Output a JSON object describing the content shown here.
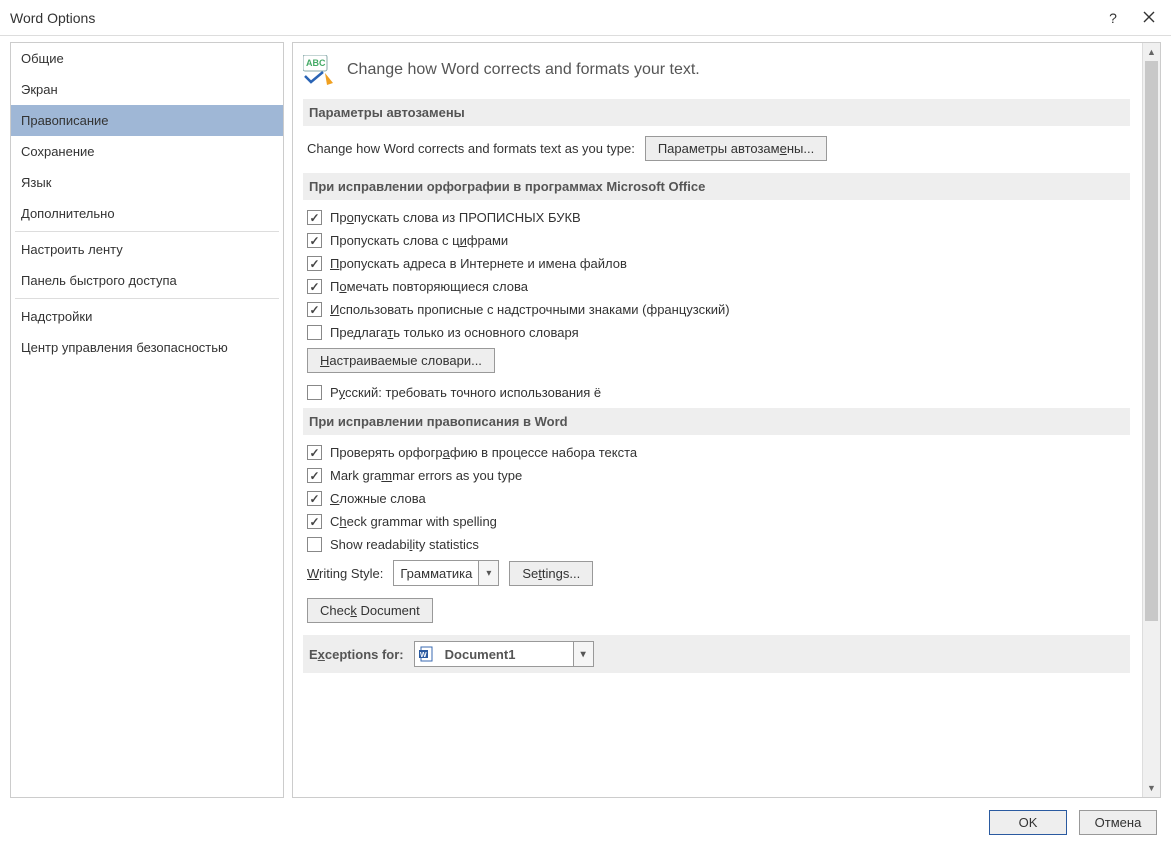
{
  "title": "Word Options",
  "sidebar": {
    "items": [
      {
        "label": "Общие"
      },
      {
        "label": "Экран"
      },
      {
        "label": "Правописание"
      },
      {
        "label": "Сохранение"
      },
      {
        "label": "Язык"
      },
      {
        "label": "Дополнительно"
      },
      {
        "label": "Настроить ленту"
      },
      {
        "label": "Панель быстрого доступа"
      },
      {
        "label": "Надстройки"
      },
      {
        "label": "Центр управления безопасностью"
      }
    ],
    "selected": 2
  },
  "hero": "Change how Word corrects and formats your text.",
  "section1": {
    "header": "Параметры автозамены",
    "desc": "Change how Word corrects and formats text as you type:",
    "button": "Параметры автозамены..."
  },
  "section2": {
    "header": "При исправлении орфографии в программах Microsoft Office",
    "checks": [
      {
        "checked": true,
        "label": "Пропускать слова из ПРОПИСНЫХ БУКВ"
      },
      {
        "checked": true,
        "label": "Пропускать слова с цифрами"
      },
      {
        "checked": true,
        "label": "Пропускать адреса в Интернете и имена файлов"
      },
      {
        "checked": true,
        "label": "Помечать повторяющиеся слова"
      },
      {
        "checked": true,
        "label": "Использовать прописные с надстрочными знаками (французский)"
      },
      {
        "checked": false,
        "label": "Предлагать только из основного словаря"
      }
    ],
    "custom_dict_btn": "Настраиваемые словари...",
    "check7": {
      "checked": false,
      "label": "Русский: требовать точного использования ё"
    }
  },
  "section3": {
    "header": "При исправлении правописания в Word",
    "checks": [
      {
        "checked": true,
        "label": "Проверять орфографию в процессе набора текста"
      },
      {
        "checked": true,
        "label": "Mark grammar errors as you type"
      },
      {
        "checked": true,
        "label": "Сложные слова"
      },
      {
        "checked": true,
        "label": "Check grammar with spelling"
      },
      {
        "checked": false,
        "label": "Show readability statistics"
      }
    ],
    "writing_style_label": "Writing Style:",
    "writing_style_value": "Грамматика",
    "settings_btn": "Settings...",
    "check_doc_btn": "Check Document"
  },
  "section4": {
    "header_prefix": "Exceptions for:",
    "doc": "Document1"
  },
  "footer": {
    "ok": "OK",
    "cancel": "Отмена"
  }
}
